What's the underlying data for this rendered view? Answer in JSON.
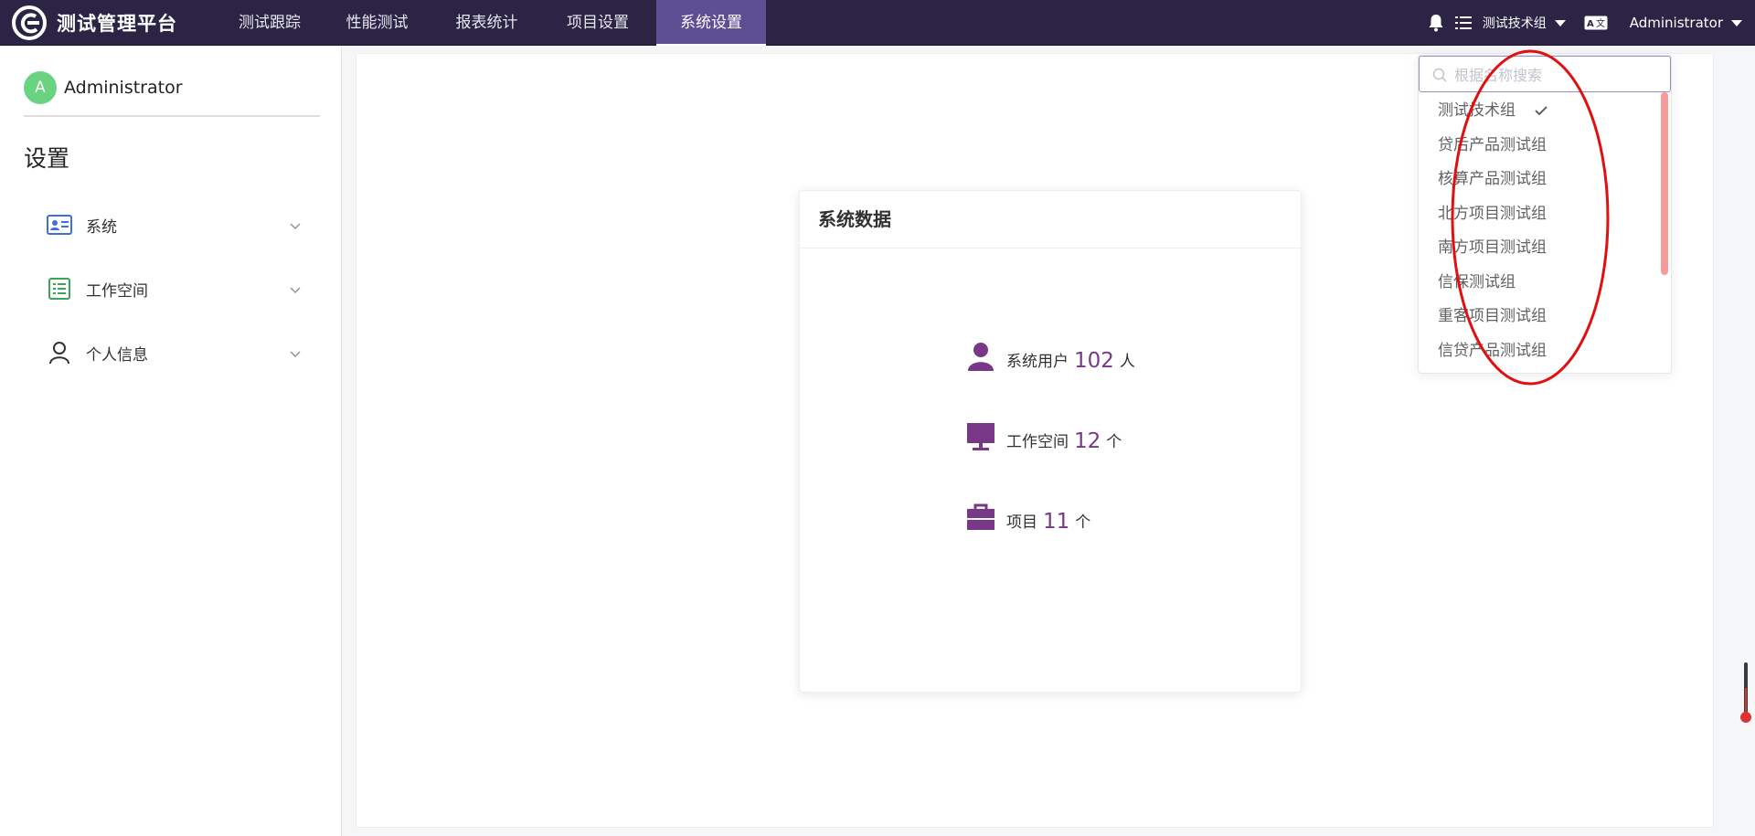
{
  "header": {
    "brand_title": "测试管理平台",
    "nav": [
      {
        "label": "测试跟踪",
        "active": false
      },
      {
        "label": "性能测试",
        "active": false
      },
      {
        "label": "报表统计",
        "active": false
      },
      {
        "label": "项目设置",
        "active": false
      },
      {
        "label": "系统设置",
        "active": true
      }
    ],
    "workspace_selector_label": "测试技术组",
    "user_menu_label": "Administrator",
    "icons": [
      "bell-icon",
      "checklist-icon",
      "language-icon"
    ]
  },
  "sidebar": {
    "avatar_letter": "A",
    "user_name": "Administrator",
    "section_title": "设置",
    "menu": [
      {
        "label": "系统",
        "icon": "id-card-icon"
      },
      {
        "label": "工作空间",
        "icon": "list-icon"
      },
      {
        "label": "个人信息",
        "icon": "person-icon"
      }
    ]
  },
  "card": {
    "title": "系统数据",
    "stats": [
      {
        "label": "系统用户",
        "value": "102",
        "unit": "人",
        "icon": "user-icon"
      },
      {
        "label": "工作空间",
        "value": "12",
        "unit": "个",
        "icon": "monitor-icon"
      },
      {
        "label": "项目",
        "value": "11",
        "unit": "个",
        "icon": "briefcase-icon"
      }
    ]
  },
  "dropdown": {
    "search_placeholder": "根据名称搜索",
    "items": [
      {
        "label": "测试技术组",
        "selected": true
      },
      {
        "label": "贷后产品测试组",
        "selected": false
      },
      {
        "label": "核算产品测试组",
        "selected": false
      },
      {
        "label": "北方项目测试组",
        "selected": false
      },
      {
        "label": "南方项目测试组",
        "selected": false
      },
      {
        "label": "信保测试组",
        "selected": false
      },
      {
        "label": "重客项目测试组",
        "selected": false
      },
      {
        "label": "信贷产品测试组",
        "selected": false
      }
    ]
  },
  "colors": {
    "topbar": "#2b2444",
    "nav_active": "#5d4f94",
    "accent": "#783887",
    "avatar": "#69d37f",
    "annotation": "#e01010"
  }
}
